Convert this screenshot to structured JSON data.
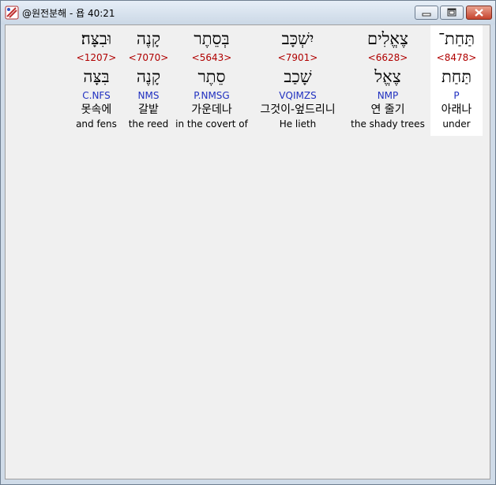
{
  "window": {
    "title": "@원전분해 - 욥 40:21"
  },
  "words": [
    {
      "hebrew": "תַּחַת־",
      "strong": "<8478>",
      "lemma": "תַּחַת",
      "parse": "P",
      "korean": "아래나",
      "english": "under",
      "selected": true
    },
    {
      "hebrew": "צֶאֱלִים",
      "strong": "<6628>",
      "lemma": "צֶאֱל",
      "parse": "NMP",
      "korean": "연 줄기",
      "english": "the shady trees",
      "selected": false
    },
    {
      "hebrew": "יִשְׁכָּב",
      "strong": "<7901>",
      "lemma": "שָׁכַב",
      "parse": "VQIMZS",
      "korean": "그것이-엎드리니",
      "english": "He lieth",
      "selected": false
    },
    {
      "hebrew": "בְּסֵתֶר",
      "strong": "<5643>",
      "lemma": "סֵתֶר",
      "parse": "P.NMSG",
      "korean": "가운데나",
      "english": "in the covert of",
      "selected": false
    },
    {
      "hebrew": "קָנֶה",
      "strong": "<7070>",
      "lemma": "קָנֶה",
      "parse": "NMS",
      "korean": "갈밭",
      "english": "the reed",
      "selected": false
    },
    {
      "hebrew": "וּבִצָּה׃",
      "strong": "<1207>",
      "lemma": "בִּצָּה",
      "parse": "C.NFS",
      "korean": "못속에",
      "english": "and fens",
      "selected": false
    }
  ]
}
